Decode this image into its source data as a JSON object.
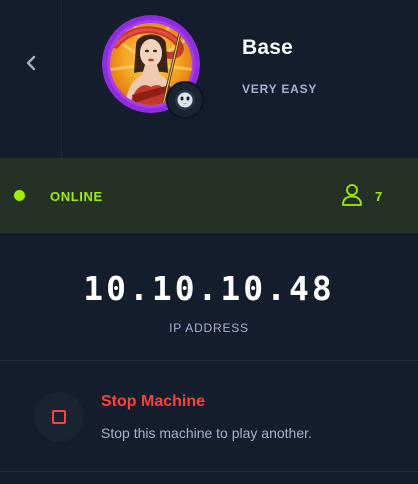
{
  "header": {
    "back_icon": "chevron-left-icon",
    "machine_name": "Base",
    "difficulty": "VERY EASY",
    "avatar": "machine-avatar-illustration",
    "os_icon": "linux-penguin-icon"
  },
  "status": {
    "state": "ONLINE",
    "players_icon": "user-icon",
    "players_count": "7",
    "color": "#9fef00"
  },
  "connection": {
    "ip_address": "10.10.10.48",
    "ip_label": "IP ADDRESS"
  },
  "stop_action": {
    "title": "Stop Machine",
    "description": "Stop this machine to play another.",
    "icon": "stop-square-icon",
    "color": "#ff3e3e"
  }
}
